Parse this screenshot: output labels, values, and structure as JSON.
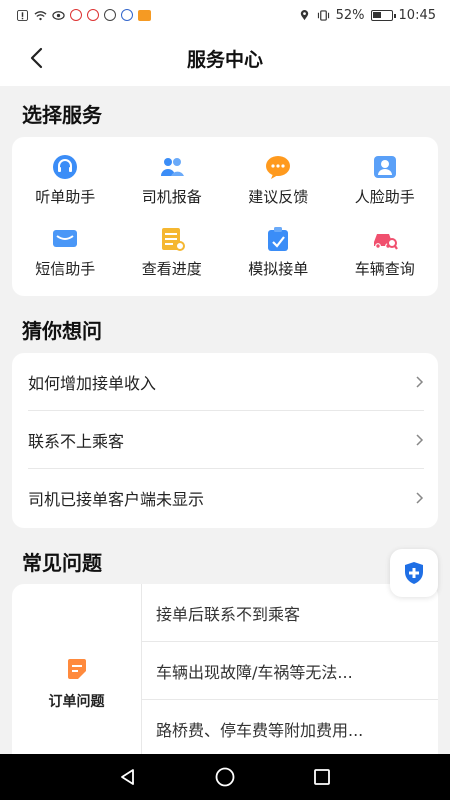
{
  "status_bar": {
    "battery": "52%",
    "time": "10:45",
    "battery_level": 0.52
  },
  "header": {
    "title": "服务中心"
  },
  "select_service": {
    "title": "选择服务",
    "items": [
      {
        "label": "听单助手",
        "icon": "headset-icon",
        "color": "#3b8df7"
      },
      {
        "label": "司机报备",
        "icon": "group-icon",
        "color": "#3b8df7"
      },
      {
        "label": "建议反馈",
        "icon": "chat-bubble-icon",
        "color": "#ff9a1e"
      },
      {
        "label": "人脸助手",
        "icon": "face-id-icon",
        "color": "#3b8df7"
      },
      {
        "label": "短信助手",
        "icon": "message-icon",
        "color": "#3b8df7"
      },
      {
        "label": "查看进度",
        "icon": "progress-icon",
        "color": "#f5b731"
      },
      {
        "label": "模拟接单",
        "icon": "clipboard-icon",
        "color": "#3b8df7"
      },
      {
        "label": "车辆查询",
        "icon": "car-search-icon",
        "color": "#f0506e"
      }
    ]
  },
  "guess": {
    "title": "猜你想问",
    "items": [
      "如何增加接单收入",
      "联系不上乘客",
      "司机已接单客户端未显示"
    ]
  },
  "common": {
    "title": "常见问题",
    "category": {
      "label": "订单问题",
      "icon": "order-icon",
      "color": "#ff8a3d"
    },
    "questions": [
      "接单后联系不到乘客",
      "车辆出现故障/车祸等无法...",
      "路桥费、停车费等附加费用..."
    ]
  },
  "floating": {
    "icon": "shield-plus-icon",
    "color": "#1f6fe5"
  },
  "nav": {
    "back": "back-triangle-icon",
    "home": "home-circle-icon",
    "recent": "recent-square-icon"
  }
}
